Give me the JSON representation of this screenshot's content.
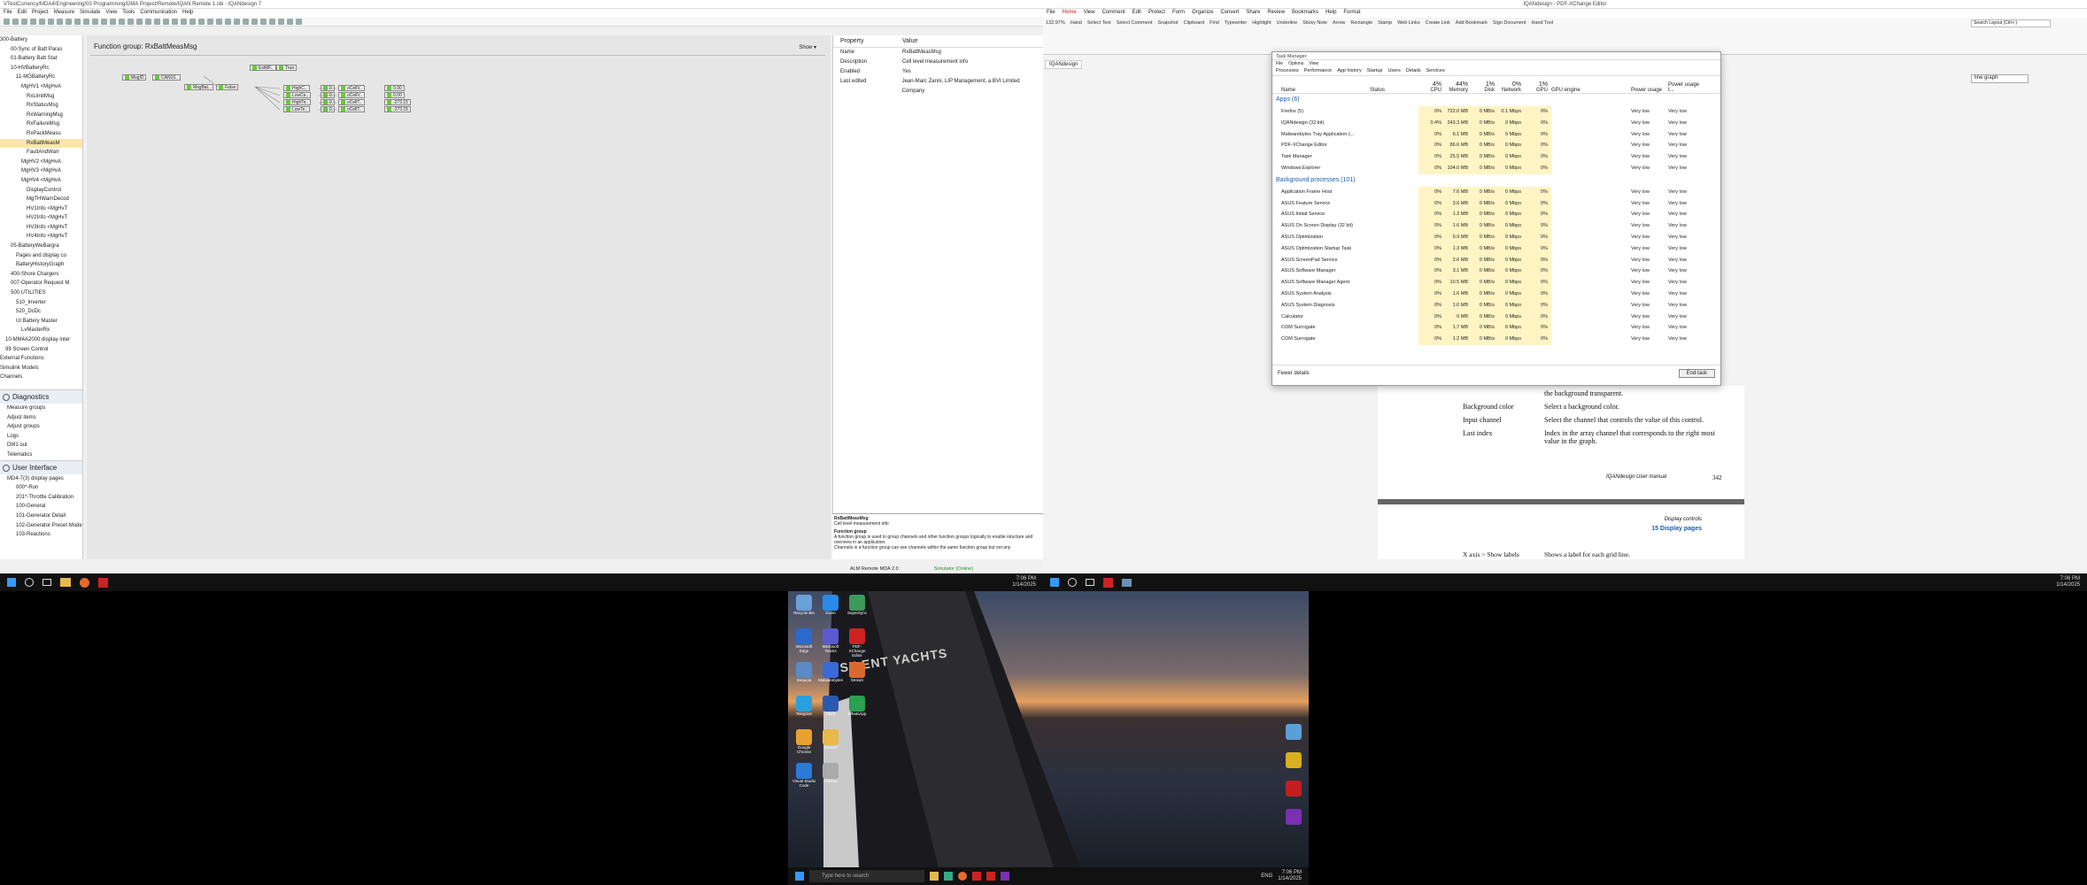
{
  "left_app": {
    "title": "VTestCurrency/MDA4/Engineering/03 Programming/DMA Project/Remote/IQAN Remote 1.sbi - IQANdesign 7",
    "menu": [
      "File",
      "Edit",
      "Project",
      "Measure",
      "Simulate",
      "View",
      "Tools",
      "Communication",
      "Help"
    ],
    "tree": [
      "300-Battery",
      "00-Sync of Batt Paras",
      "01-Battery Batt Stat",
      "10-HVBatteryRc",
      "11-MGBatteryRc",
      "MgHV1 <MgHvA",
      "RxLimitMsg",
      "RxStatusMsg",
      "RxWarningMsg",
      "RxFailureMsg",
      "RxPackMeasu",
      "RxBattMeasM",
      "FaultAndWarr",
      "MgHV2 <MgHvA",
      "MgHV3 <MgHvA",
      "MgHV4 <MgHvA",
      "DisplayControl",
      "MgTHWarnDecod",
      "HV1Info <MgHvT",
      "HV2Info <MgHvT",
      "HV3Info <MgHvT",
      "HV4Info <MgHvT",
      "05-BatteryWeBargra",
      "Pages and display co",
      "BatteryHistoryGraph",
      "400-Shore Chargers",
      "007-Operator Request M",
      "500 UTILITIES",
      "510_Inverter",
      "520_DcDc",
      "UI Battery Master",
      "LvMasterRx",
      "10-MM4A2000 display inter",
      "99 Screen Control",
      "External Functions",
      "Simulink Models",
      "Channels"
    ],
    "selected_tree_index": 11,
    "diagnostics_title": "Diagnostics",
    "diagnostics_items": [
      "Measure groups",
      "Adjust items",
      "Adjust groups",
      "Logs",
      "DM1 out",
      "Telematics"
    ],
    "ui_title": "User Interface",
    "ui_items": [
      "MD4-7(3) display pages",
      "000*-Run",
      "201*-Throttle Calibration",
      "100-General",
      "101-Generator Detail",
      "102-Generator Preset Mode",
      "103-Reactions"
    ],
    "canvas_title": "Function group: RxBattMeasMsg",
    "canvas_show": "Show ▾",
    "blocks": [
      "MsgID",
      "CAN10..",
      "MsgBat..",
      "False",
      "EstMF..",
      "True",
      "HighC..",
      "0",
      "LowCe..",
      "0",
      "HighTe..",
      "0",
      "LowTe..",
      "0",
      "oCellV..",
      "0.00",
      "oCellV..",
      "0.00",
      "oCellT..",
      "-273.15",
      "oCellT..",
      "-273.15"
    ],
    "props_header_property": "Property",
    "props_header_value": "Value",
    "props": [
      {
        "k": "Name",
        "v": "RxBattMeasMsg"
      },
      {
        "k": "Description",
        "v": "Cell level measurement info"
      },
      {
        "k": "Enabled",
        "v": "Yes"
      },
      {
        "k": "Last edited",
        "v": "Jean-Marc Zanni, LIP Management, a BVI Limited Company"
      }
    ],
    "help_name": "RxBattMeasMsg",
    "help_desc": "Cell level measurement info",
    "help_title": "Function group",
    "help_text": "A function group is used to group channels and other function groups logically to enable structure and overview in an application.",
    "help_text2": "Channels in a function group can see channels within the same function group but not any",
    "status_left": "ALM Remote MDA 2.0",
    "status_right": "Simulator (Online)",
    "clock_time": "7:06 PM",
    "clock_date": "1/14/2025"
  },
  "right_app": {
    "title": "IQANdesign - PDF-XChange Editor",
    "ribbon_tabs": [
      "File",
      "Home",
      "View",
      "Comment",
      "Edit",
      "Protect",
      "Form",
      "Organize",
      "Convert",
      "Share",
      "Review",
      "Bookmarks",
      "Help",
      "Format"
    ],
    "active_tab": "Home",
    "hand_tool": "Hand Tool",
    "ribbon_buttons": [
      "Hand",
      "Select Text",
      "Select Comment",
      "Snapshot",
      "Clipboard",
      "Find",
      "Typewriter",
      "Highlight",
      "Underline",
      "Sticky Note",
      "Arrow",
      "Rectangle",
      "Stamp",
      "Web Links",
      "Create Link",
      "Add Bookmark",
      "Sign Document"
    ],
    "zoom": "132.97%",
    "search_box": "Search Layout (Ctrl+.)",
    "find_box": "line graph",
    "doc_tab": "IQANdesign",
    "doc_rows": [
      {
        "k": "",
        "v": "the background transparent."
      },
      {
        "k": "Background color",
        "v": "Select a background color."
      },
      {
        "k": "Input channel",
        "v": "Select the channel that controls the value of this control."
      },
      {
        "k": "Last index",
        "v": "Index in the array channel that corresponds to the right most value in the graph."
      }
    ],
    "doc_footer": "IQANdesign User manual",
    "doc_page": "342",
    "doc2_heading": "Display controls",
    "doc2_section": "15   Display pages",
    "doc2_row_k": "X axis > Show labels",
    "doc2_row_v": "Shows a label for each grid line.",
    "clock_time": "7:06 PM",
    "clock_date": "1/14/2025"
  },
  "task_manager": {
    "title": "Task Manager",
    "menu": [
      "File",
      "Options",
      "View"
    ],
    "tabs": [
      "Processes",
      "Performance",
      "App history",
      "Startup",
      "Users",
      "Details",
      "Services"
    ],
    "cols": {
      "name": "Name",
      "status": "Status",
      "cpu": "CPU",
      "mem": "Memory",
      "disk": "Disk",
      "net": "Network",
      "gpu": "GPU",
      "gpue": "GPU engine",
      "pw": "Power usage",
      "pwt": "Power usage t..."
    },
    "totals": {
      "cpu": "4%",
      "mem": "44%",
      "disk": "1%",
      "net": "0%",
      "gpu": "1%"
    },
    "apps_header": "Apps (6)",
    "apps": [
      {
        "n": "Firefox (5)",
        "cpu": "0%",
        "mem": "722.0 MB",
        "disk": "0 MB/s",
        "net": "0.1 Mbps",
        "gpu": "0%",
        "pw": "Very low",
        "pwt": "Very low"
      },
      {
        "n": "IQANdesign (32 bit)",
        "cpu": "0.4%",
        "mem": "243.3 MB",
        "disk": "0 MB/s",
        "net": "0 Mbps",
        "gpu": "0%",
        "pw": "Very low",
        "pwt": "Very low"
      },
      {
        "n": "Malwarebytes Tray Application (...",
        "cpu": "0%",
        "mem": "6.1 MB",
        "disk": "0 MB/s",
        "net": "0 Mbps",
        "gpu": "0%",
        "pw": "Very low",
        "pwt": "Very low"
      },
      {
        "n": "PDF-XChange Editor",
        "cpu": "0%",
        "mem": "86.6 MB",
        "disk": "0 MB/s",
        "net": "0 Mbps",
        "gpu": "0%",
        "pw": "Very low",
        "pwt": "Very low"
      },
      {
        "n": "Task Manager",
        "cpu": "0%",
        "mem": "25.5 MB",
        "disk": "0 MB/s",
        "net": "0 Mbps",
        "gpu": "0%",
        "pw": "Very low",
        "pwt": "Very low"
      },
      {
        "n": "Windows Explorer",
        "cpu": "0%",
        "mem": "104.0 MB",
        "disk": "0 MB/s",
        "net": "0 Mbps",
        "gpu": "0%",
        "pw": "Very low",
        "pwt": "Very low"
      }
    ],
    "bg_header": "Background processes (101)",
    "bg": [
      {
        "n": "Application Frame Host",
        "mem": "7.6 MB"
      },
      {
        "n": "ASUS Feature Service",
        "mem": "3.6 MB"
      },
      {
        "n": "ASUS Initial Service",
        "mem": "1.3 MB"
      },
      {
        "n": "ASUS On Screen Display (32 bit)",
        "mem": "1.6 MB"
      },
      {
        "n": "ASUS Optimization",
        "mem": "0.9 MB"
      },
      {
        "n": "ASUS Optimization Startup Task",
        "mem": "1.3 MB"
      },
      {
        "n": "ASUS ScreenPad Service",
        "mem": "2.6 MB"
      },
      {
        "n": "ASUS Software Manager",
        "mem": "3.1 MB"
      },
      {
        "n": "ASUS Software Manager Agent",
        "mem": "10.5 MB"
      },
      {
        "n": "ASUS System Analysis",
        "mem": "1.6 MB"
      },
      {
        "n": "ASUS System Diagnosis",
        "mem": "1.0 MB"
      },
      {
        "n": "Calculator",
        "mem": "0 MB"
      },
      {
        "n": "COM Surrogate",
        "mem": "1.7 MB"
      },
      {
        "n": "COM Surrogate",
        "mem": "1.2 MB"
      }
    ],
    "fewer": "Fewer details",
    "end_task": "End task"
  },
  "desktop": {
    "icons": [
      "Recycle Bin",
      "Microsoft Edge",
      "Sequoia",
      "Telegram",
      "Google Chrome",
      "Visual Studio Code",
      "Zoom",
      "Microsoft Teams",
      "Malwarebytes",
      "Word",
      "Shared",
      "Ableton",
      "SuperSync",
      "PDF-XChange Editor",
      "Stream",
      "WhatsApp"
    ],
    "boat_text": "SILENT YACHTS",
    "search_placeholder": "Type here to search",
    "clock_time": "7:06 PM",
    "clock_date": "1/14/2025",
    "lang": "ENG"
  }
}
